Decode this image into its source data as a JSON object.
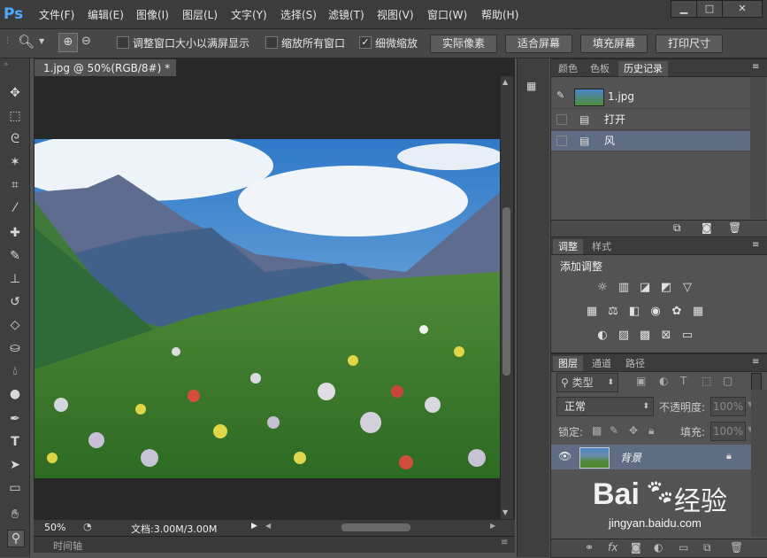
{
  "app": {
    "logo": "Ps",
    "menu": [
      "文件(F)",
      "编辑(E)",
      "图像(I)",
      "图层(L)",
      "文字(Y)",
      "选择(S)",
      "滤镜(T)",
      "视图(V)",
      "窗口(W)",
      "帮助(H)"
    ],
    "window_buttons": [
      "▁",
      "□",
      "✕"
    ]
  },
  "options": {
    "checks": [
      {
        "label": "调整窗口大小以满屏显示",
        "checked": false
      },
      {
        "label": "缩放所有窗口",
        "checked": false
      },
      {
        "label": "细微缩放",
        "checked": true
      }
    ],
    "buttons": [
      "实际像素",
      "适合屏幕",
      "填充屏幕",
      "打印尺寸"
    ]
  },
  "document": {
    "tab_title": "1.jpg @ 50%(RGB/8#) *",
    "zoom": "50%",
    "doc_info": "文档:3.00M/3.00M",
    "timeline_label": "时间轴"
  },
  "history_panel": {
    "tabs": [
      "颜色",
      "色板",
      "历史记录"
    ],
    "active_tab": 2,
    "snapshot": "1.jpg",
    "items": [
      "打开",
      "风"
    ],
    "selected_item": 1
  },
  "adjust_panel": {
    "tabs": [
      "调整",
      "样式"
    ],
    "title": "添加调整"
  },
  "layers_panel": {
    "tabs": [
      "图层",
      "通道",
      "路径"
    ],
    "filter_label": "类型",
    "blend_mode": "正常",
    "opacity_label": "不透明度:",
    "opacity_value": "100%",
    "lock_label": "锁定:",
    "fill_label": "填充:",
    "fill_value": "100%",
    "layer_name": "背景"
  },
  "watermark": {
    "brand": "Bai",
    "brand_cn": "经验",
    "url": "jingyan.baidu.com"
  },
  "colors": {
    "accent": "#4fa9ff",
    "selected_row": "#5f6d84",
    "panel_bg": "#535353"
  }
}
